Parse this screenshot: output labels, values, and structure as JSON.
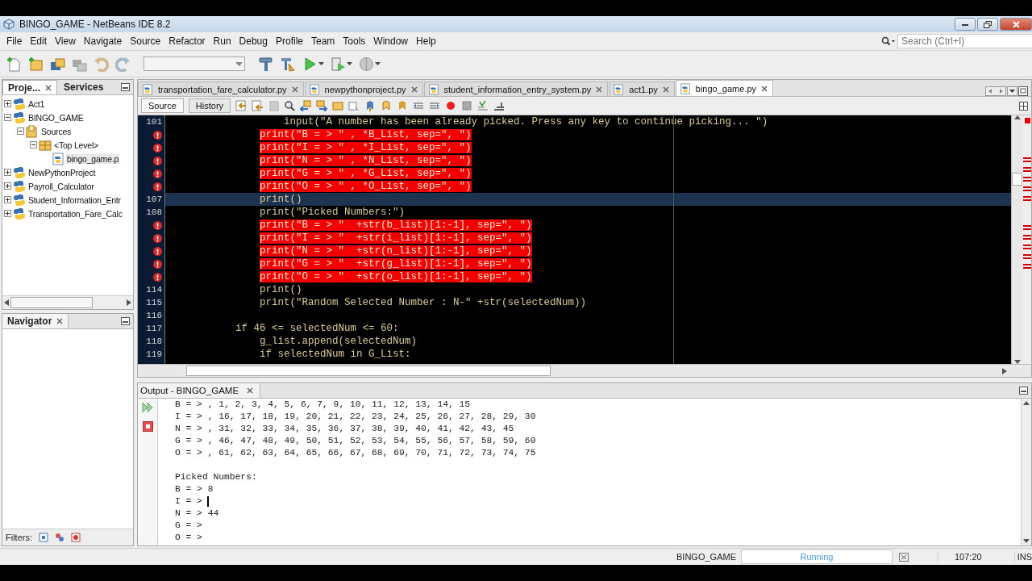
{
  "window": {
    "title": "BINGO_GAME - NetBeans IDE 8.2"
  },
  "menu": [
    "File",
    "Edit",
    "View",
    "Navigate",
    "Source",
    "Refactor",
    "Run",
    "Debug",
    "Profile",
    "Team",
    "Tools",
    "Window",
    "Help"
  ],
  "search": {
    "placeholder": "Search (Ctrl+I)"
  },
  "projects_panel": {
    "tabs": [
      {
        "label": "Proje...",
        "selected": true
      },
      {
        "label": "Services",
        "selected": false
      }
    ],
    "tree": [
      {
        "label": "Act1",
        "kind": "project",
        "expanded": false,
        "selected": false
      },
      {
        "label": "BINGO_GAME",
        "kind": "project",
        "expanded": true,
        "selected": false,
        "children": [
          {
            "label": "Sources",
            "kind": "folder",
            "expanded": true,
            "selected": false,
            "children": [
              {
                "label": "<Top Level>",
                "kind": "package",
                "expanded": true,
                "selected": false,
                "children": [
                  {
                    "label": "bingo_game.p",
                    "kind": "file",
                    "selected": true
                  }
                ]
              }
            ]
          }
        ]
      },
      {
        "label": "NewPythonProject",
        "kind": "project",
        "expanded": false,
        "selected": false
      },
      {
        "label": "Payroll_Calculator",
        "kind": "project",
        "expanded": false,
        "selected": false
      },
      {
        "label": "Student_Information_Entr",
        "kind": "project",
        "expanded": false,
        "selected": false
      },
      {
        "label": "Transportation_Fare_Calc",
        "kind": "project",
        "expanded": false,
        "selected": false
      }
    ]
  },
  "navigator": {
    "title": "Navigator",
    "filters_label": "Filters:"
  },
  "editor": {
    "tabs": [
      {
        "label": "transportation_fare_calculator.py",
        "selected": false
      },
      {
        "label": "newpythonproject.py",
        "selected": false
      },
      {
        "label": "student_information_entry_system.py",
        "selected": false
      },
      {
        "label": "act1.py",
        "selected": false
      },
      {
        "label": "bingo_game.py",
        "selected": true
      }
    ],
    "views": [
      {
        "label": "Source",
        "selected": true
      },
      {
        "label": "History",
        "selected": false
      }
    ],
    "lines": [
      {
        "number": "101",
        "error": false,
        "current": false,
        "text": "                input(\"A number has been already picked. Press any key to continue picking... \")"
      },
      {
        "error": true,
        "current": false,
        "text": "            print(\"B = > \" , *B_List, sep=\", \")"
      },
      {
        "error": true,
        "current": false,
        "text": "            print(\"I = > \" , *I_List, sep=\", \")"
      },
      {
        "error": true,
        "current": false,
        "text": "            print(\"N = > \" , *N_List, sep=\", \")"
      },
      {
        "error": true,
        "current": false,
        "text": "            print(\"G = > \" , *G_List, sep=\", \")"
      },
      {
        "error": true,
        "current": false,
        "text": "            print(\"O = > \" , *O_List, sep=\", \")"
      },
      {
        "number": "107",
        "error": false,
        "current": true,
        "text": "            print()"
      },
      {
        "number": "108",
        "error": false,
        "current": false,
        "text": "            print(\"Picked Numbers:\")"
      },
      {
        "error": true,
        "current": false,
        "text": "            print(\"B = > \"  +str(b_list)[1:-1], sep=\", \")"
      },
      {
        "error": true,
        "current": false,
        "text": "            print(\"I = > \"  +str(i_list)[1:-1], sep=\", \")"
      },
      {
        "error": true,
        "current": false,
        "text": "            print(\"N = > \"  +str(n_list)[1:-1], sep=\", \")"
      },
      {
        "error": true,
        "current": false,
        "text": "            print(\"G = > \"  +str(g_list)[1:-1], sep=\", \")"
      },
      {
        "error": true,
        "current": false,
        "text": "            print(\"O = > \"  +str(o_list)[1:-1], sep=\", \")"
      },
      {
        "number": "114",
        "error": false,
        "current": false,
        "text": "            print()"
      },
      {
        "number": "115",
        "error": false,
        "current": false,
        "text": "            print(\"Random Selected Number : N-\" +str(selectedNum))"
      },
      {
        "number": "116",
        "error": false,
        "current": false
      },
      {
        "number": "117",
        "error": false,
        "current": false,
        "text": "        if 46 <= selectedNum <= 60:"
      },
      {
        "number": "118",
        "error": false,
        "current": false,
        "text": "            g_list.append(selectedNum)"
      },
      {
        "number": "119",
        "error": false,
        "current": false,
        "text": "            if selectedNum in G_List:"
      }
    ]
  },
  "output": {
    "title": "Output - BINGO_GAME",
    "blocks": [
      [
        {
          "text": "B = > , 1, 2, 3, 4, 5, 6, 7, 9, 10, 11, 12, 13, 14, 15",
          "cursor": false
        },
        {
          "text": "I = > , 16, 17, 18, 19, 20, 21, 22, 23, 24, 25, 26, 27, 28, 29, 30",
          "cursor": false
        },
        {
          "text": "N = > , 31, 32, 33, 34, 35, 36, 37, 38, 39, 40, 41, 42, 43, 45",
          "cursor": false
        },
        {
          "text": "G = > , 46, 47, 48, 49, 50, 51, 52, 53, 54, 55, 56, 57, 58, 59, 60",
          "cursor": false
        },
        {
          "text": "O = > , 61, 62, 63, 64, 65, 66, 67, 68, 69, 70, 71, 72, 73, 74, 75",
          "cursor": false
        }
      ],
      [
        {
          "text": "Picked Numbers:",
          "cursor": false
        },
        {
          "text": "B = > 8",
          "cursor": false
        },
        {
          "text": "I = >",
          "cursor": true
        },
        {
          "text": "N = > 44",
          "cursor": false
        },
        {
          "text": "G = >",
          "cursor": false
        },
        {
          "text": "O = >",
          "cursor": false
        }
      ]
    ]
  },
  "status_bar": {
    "project": "BINGO_GAME",
    "task": "Running",
    "position": "107:20",
    "mode": "INS"
  }
}
